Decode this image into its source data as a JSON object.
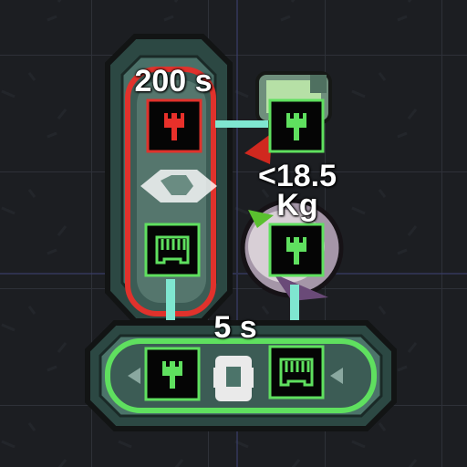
{
  "timer_gate": {
    "label": "200 s",
    "input_port_state": "red-signal",
    "gate_icon": "buffer-gate-icon",
    "output_port_state": "green-signal"
  },
  "weight_sensor": {
    "label_line1": "<18.5",
    "label_line2": "Kg",
    "top_port_state": "green-signal",
    "bottom_port_state": "green-signal"
  },
  "filter_gate": {
    "label": "5 s",
    "left_port_state": "green-signal",
    "gate_icon": "filter-gate-icon",
    "right_port_state": "green-signal"
  },
  "colors": {
    "active": "#5fe05f",
    "inactive": "#e8302a",
    "wire": "#7fe6d0",
    "frame": "#2d4a44"
  }
}
